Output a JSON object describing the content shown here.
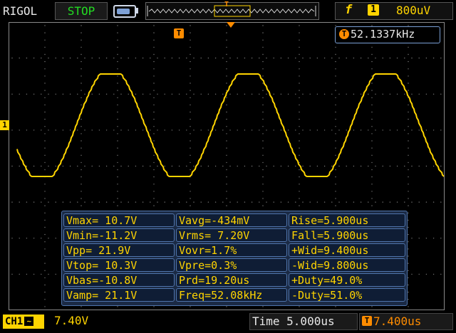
{
  "header": {
    "brand": "RIGOL",
    "run_state": "STOP",
    "trigger_level": "800uV",
    "trigger_source_mark": "1",
    "trigger_edge_glyph": "f",
    "memory_marker": "T"
  },
  "display": {
    "trigger_marker": "T",
    "frequency_counter_marker": "T",
    "frequency_counter": "52.1337kHz",
    "ch1_marker": "1"
  },
  "measurements": {
    "rows": [
      [
        "Vmax= 10.7V",
        "Vavg=-434mV",
        "Rise=5.900us"
      ],
      [
        "Vmin=-11.2V",
        "Vrms= 7.20V",
        "Fall=5.900us"
      ],
      [
        "Vpp= 21.9V",
        "Vovr=1.7%",
        "+Wid=9.400us"
      ],
      [
        "Vtop= 10.3V",
        "Vpre=0.3%",
        "-Wid=9.800us"
      ],
      [
        "Vbas=-10.8V",
        "Prd=19.20us",
        "+Duty=49.0%"
      ],
      [
        "Vamp= 21.1V",
        "Freq=52.08kHz",
        "-Duty=51.0%"
      ]
    ]
  },
  "footer": {
    "ch1_label": "CH1",
    "ch1_coupling_glyph": "~",
    "ch1_scale": "7.40V",
    "timebase": "Time 5.000us",
    "offset_marker": "T",
    "offset_value": "7.400us"
  },
  "colors": {
    "ch1": "#ffd400",
    "trigger": "#ff8c00",
    "run_state": "#22dd22",
    "panel": "#1b2a44",
    "panel_border": "#4f74ac"
  }
}
